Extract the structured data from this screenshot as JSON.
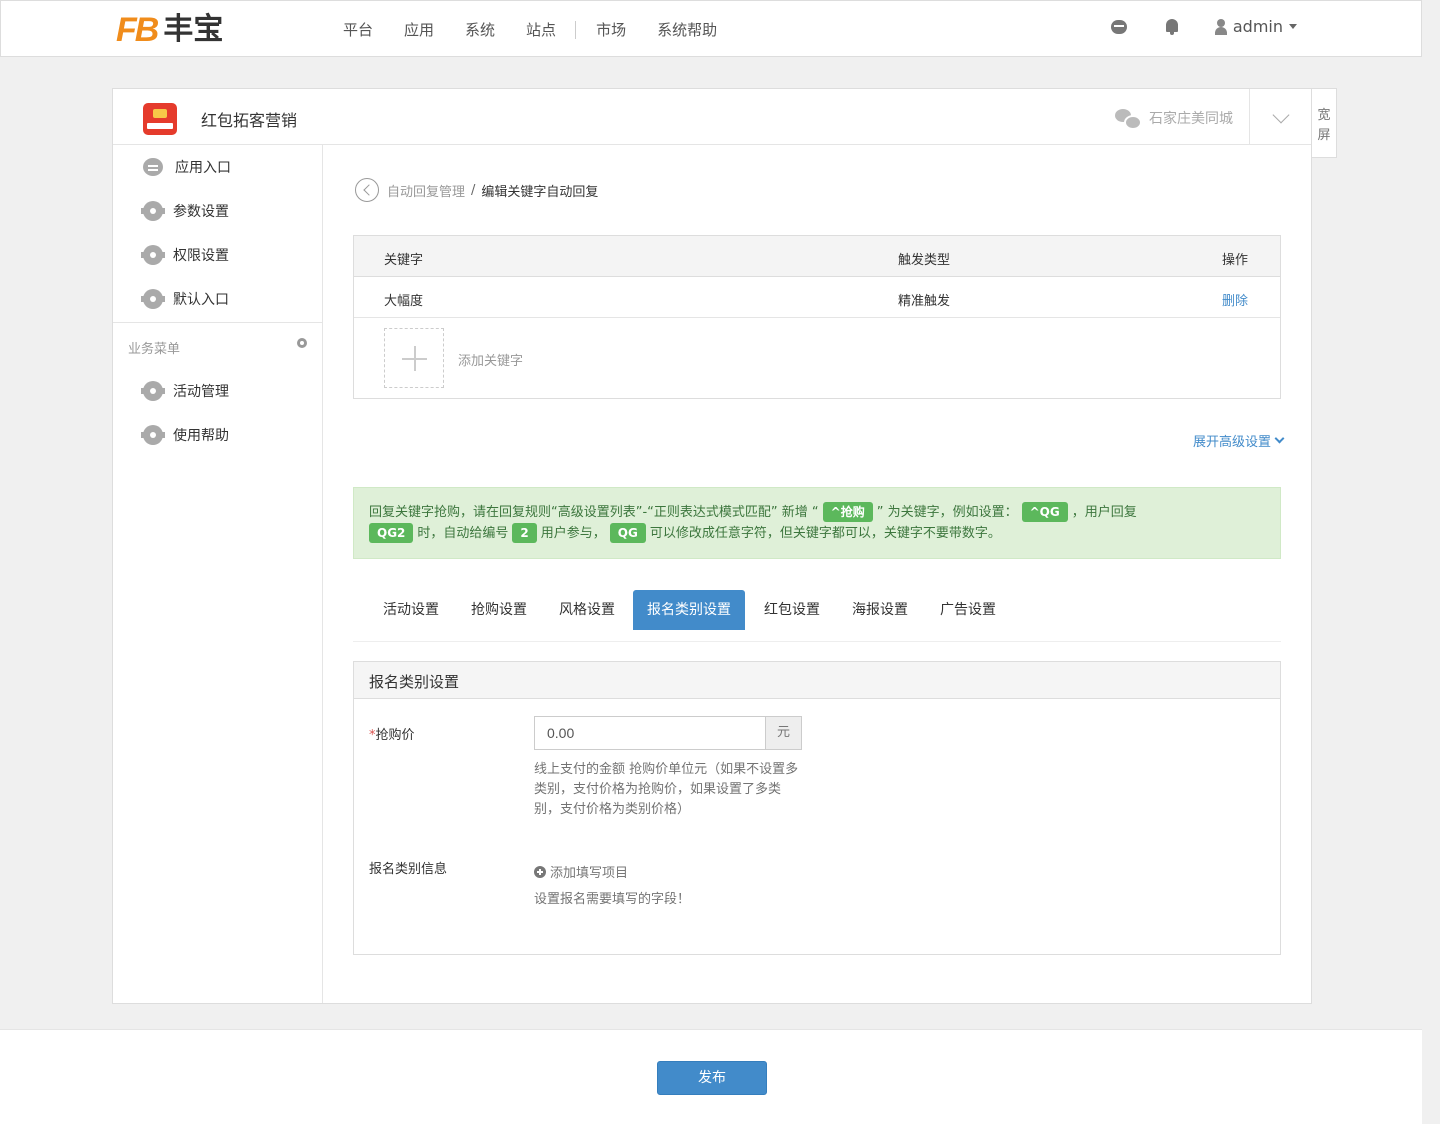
{
  "topbar": {
    "logo_fb": "FB",
    "logo_cn": "丰宝",
    "nav": [
      "平台",
      "应用",
      "系统",
      "站点",
      "市场",
      "系统帮助"
    ],
    "username": "admin"
  },
  "app": {
    "name": "红包拓客营销",
    "account": "石家庄美同城",
    "wide_label": "宽屏"
  },
  "sidebar": {
    "items": [
      "应用入口",
      "参数设置",
      "权限设置",
      "默认入口"
    ],
    "section_title": "业务菜单",
    "biz_items": [
      "活动管理",
      "使用帮助"
    ]
  },
  "breadcrumb": {
    "parent": "自动回复管理",
    "sep": "/",
    "current": "编辑关键字自动回复"
  },
  "keywords": {
    "headers": [
      "关键字",
      "触发类型",
      "操作"
    ],
    "rows": [
      {
        "keyword": "大幅度",
        "trigger": "精准触发",
        "action": "删除"
      }
    ],
    "add_label": "添加关键字"
  },
  "advanced_label": "展开高级设置",
  "alert": {
    "text1": "回复关键字抢购，请在回复规则“高级设置列表”-“正则表达式模式匹配” 新增 “",
    "tag1": "^抢购",
    "text2": "” 为关键字，例如设置：",
    "tag2": "^QG",
    "text3": "，用户回复",
    "tag3": "QG2",
    "text4": "时，自动给编号",
    "tag4": "2",
    "text5": "用户参与，",
    "tag5": "QG",
    "text6": "可以修改成任意字符，但关键字都可以，关键字不要带数字。"
  },
  "tabs": [
    "活动设置",
    "抢购设置",
    "风格设置",
    "报名类别设置",
    "红包设置",
    "海报设置",
    "广告设置"
  ],
  "active_tab": 3,
  "form": {
    "title": "报名类别设置",
    "price_label": "抢购价",
    "price_required": "*",
    "price_value": "0.00",
    "price_unit": "元",
    "price_help": "线上支付的金额 抢购价单位元（如果不设置多类别，支付价格为抢购价，如果设置了多类别，支付价格为类别价格）",
    "info_label": "报名类别信息",
    "add_field": "添加填写项目",
    "info_help": "设置报名需要填写的字段！"
  },
  "footer": {
    "publish": "发布"
  }
}
